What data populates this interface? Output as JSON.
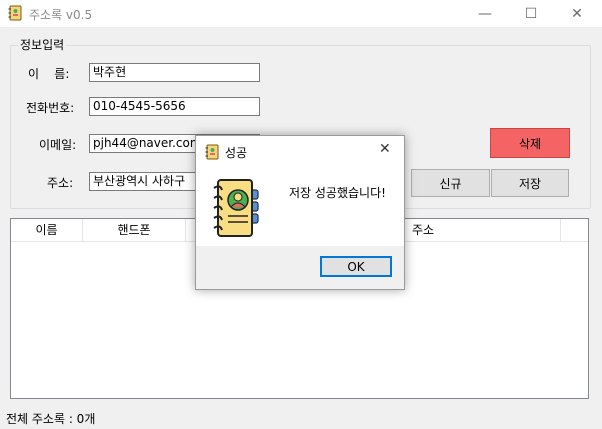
{
  "window": {
    "title": "주소록 v0.5",
    "minimize": "—",
    "maximize": "☐",
    "close": "✕"
  },
  "group": {
    "title": "정보입력"
  },
  "form": {
    "name_label": "이    름:",
    "name_value": "박주현",
    "phone_label": "전화번호:",
    "phone_value": "010-4545-5656",
    "email_label": "이메일:",
    "email_value": "pjh44@naver.com",
    "address_label": "주소:",
    "address_value": "부산광역시 사하구"
  },
  "buttons": {
    "delete": "삭제",
    "new": "신규",
    "save": "저장"
  },
  "colors": {
    "delete_bg": "#f46464",
    "accent": "#0078d7"
  },
  "list": {
    "columns": [
      "이름",
      "핸드폰",
      "",
      "주소"
    ],
    "rows": []
  },
  "status": {
    "text": "전체 주소록 : 0개"
  },
  "dialog": {
    "title": "성공",
    "message": "저장 성공했습니다!",
    "ok": "OK",
    "close": "✕",
    "icon": "address-book-icon"
  }
}
